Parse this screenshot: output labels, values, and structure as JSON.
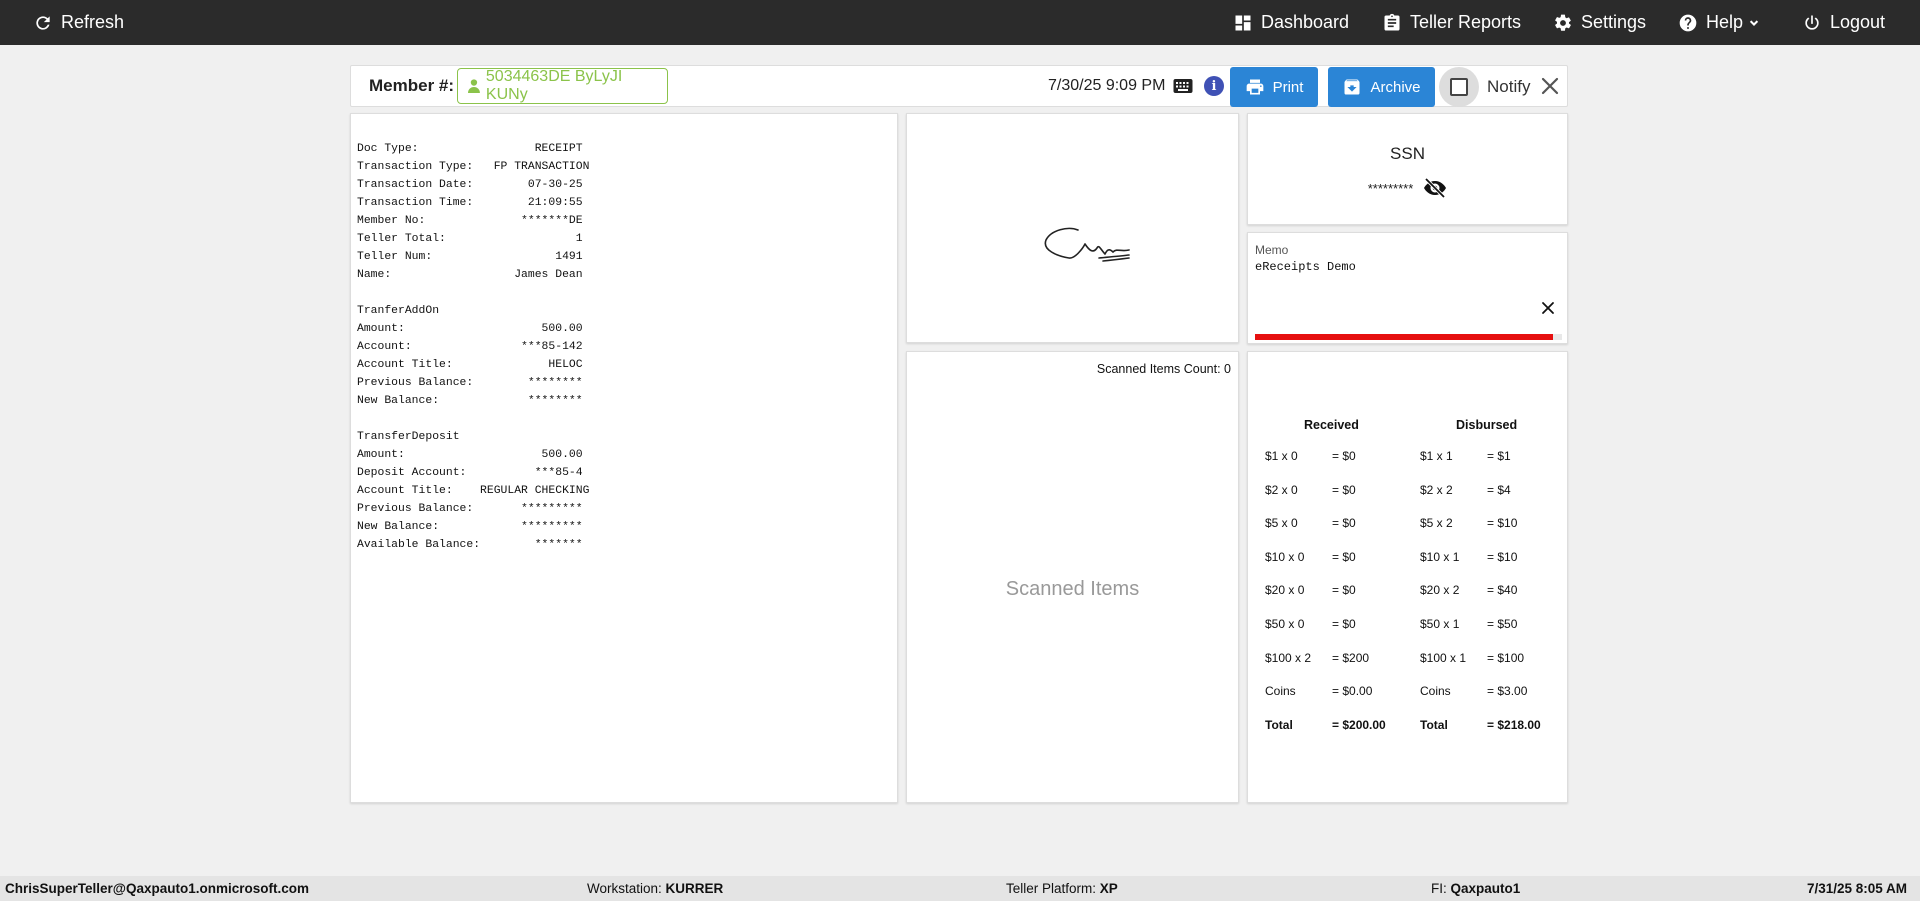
{
  "topbar": {
    "refresh": "Refresh",
    "dashboard": "Dashboard",
    "teller_reports": "Teller Reports",
    "settings": "Settings",
    "help": "Help",
    "logout": "Logout"
  },
  "header": {
    "member_label": "Member #:",
    "member_value": "5034463DE ByLyJI KUNy",
    "datetime": "7/30/25 9:09 PM",
    "print_label": "Print",
    "archive_label": "Archive",
    "notify_label": "Notify",
    "info_glyph": "i"
  },
  "receipt": {
    "rows": [
      "Doc Type:                 RECEIPT",
      "Transaction Type:   FP TRANSACTION",
      "Transaction Date:        07-30-25",
      "Transaction Time:        21:09:55",
      "Member No:              *******DE",
      "Teller Total:                   1",
      "Teller Num:                  1491",
      "Name:                  James Dean",
      "",
      "TranferAddOn",
      "Amount:                    500.00",
      "Account:                ***85-142",
      "Account Title:              HELOC",
      "Previous Balance:        ********",
      "New Balance:             ********",
      "",
      "TransferDeposit",
      "Amount:                    500.00",
      "Deposit Account:          ***85-4",
      "Account Title:    REGULAR CHECKING",
      "Previous Balance:       *********",
      "New Balance:            *********",
      "Available Balance:        *******"
    ]
  },
  "ssn": {
    "title": "SSN",
    "value": "*********"
  },
  "memo": {
    "label": "Memo",
    "value": "eReceipts Demo",
    "progress": 0.97,
    "progress_color": "#e61010"
  },
  "scanned": {
    "count_label": "Scanned Items Count: 0",
    "placeholder": "Scanned Items"
  },
  "cash": {
    "received_title": "Received",
    "disbursed_title": "Disbursed",
    "received": [
      {
        "l": "$1 x 0",
        "r": "= $0"
      },
      {
        "l": "$2 x 0",
        "r": "= $0"
      },
      {
        "l": "$5 x 0",
        "r": "= $0"
      },
      {
        "l": "$10 x 0",
        "r": "= $0"
      },
      {
        "l": "$20 x 0",
        "r": "= $0"
      },
      {
        "l": "$50 x 0",
        "r": "= $0"
      },
      {
        "l": "$100 x 2",
        "r": "= $200"
      },
      {
        "l": "Coins",
        "r": "= $0.00"
      },
      {
        "l": "Total",
        "r": "= $200.00",
        "total": true
      }
    ],
    "disbursed": [
      {
        "l": "$1 x 1",
        "r": "= $1"
      },
      {
        "l": "$2 x 2",
        "r": "= $4"
      },
      {
        "l": "$5 x 2",
        "r": "= $10"
      },
      {
        "l": "$10 x 1",
        "r": "= $10"
      },
      {
        "l": "$20 x 2",
        "r": "= $40"
      },
      {
        "l": "$50 x 1",
        "r": "= $50"
      },
      {
        "l": "$100 x 1",
        "r": "= $100"
      },
      {
        "l": "Coins",
        "r": "= $3.00"
      },
      {
        "l": "Total",
        "r": "= $218.00",
        "total": true
      }
    ]
  },
  "status": {
    "user": "ChrisSuperTeller@Qaxpauto1.onmicrosoft.com",
    "workstation_label": "Workstation:",
    "workstation": "KURRER",
    "platform_label": "Teller Platform:",
    "platform": "XP",
    "fi_label": "FI:",
    "fi": "Qaxpauto1",
    "datetime": "7/31/25 8:05 AM"
  },
  "colors": {
    "topbar": "#2b2b2b",
    "primary_button": "#2b85d6",
    "member_chip": "#8bc34a",
    "info": "#3f51b5"
  }
}
